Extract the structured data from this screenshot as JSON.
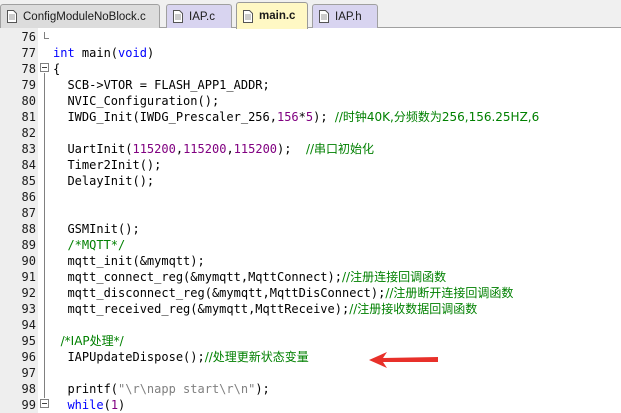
{
  "tabs": [
    {
      "label": "ConfigModuleNoBlock.c",
      "state": "inactive"
    },
    {
      "label": "IAP.c",
      "state": "inactive"
    },
    {
      "label": "main.c",
      "state": "active"
    },
    {
      "label": "IAP.h",
      "state": "inactive"
    }
  ],
  "colors": {
    "keyword": "#0000ff",
    "number": "#800080",
    "string": "#808080",
    "comment": "#008000",
    "arrow": "#e8302a",
    "active_tab": "#fff8c4"
  },
  "annotation": {
    "icon": "red-arrow-icon"
  },
  "lines": [
    {
      "n": "76",
      "parts": [
        {
          "t": ""
        }
      ]
    },
    {
      "n": "77",
      "parts": [
        {
          "t": "int",
          "c": "kw"
        },
        {
          "t": " main("
        },
        {
          "t": "void",
          "c": "kw"
        },
        {
          "t": ")"
        }
      ]
    },
    {
      "n": "78",
      "parts": [
        {
          "t": "{"
        }
      ]
    },
    {
      "n": "79",
      "parts": [
        {
          "t": "  SCB->VTOR = FLASH_APP1_ADDR;"
        }
      ]
    },
    {
      "n": "80",
      "parts": [
        {
          "t": "  NVIC_Configuration();"
        }
      ]
    },
    {
      "n": "81",
      "parts": [
        {
          "t": "  IWDG_Init(IWDG_Prescaler_256,"
        },
        {
          "t": "156",
          "c": "num"
        },
        {
          "t": "*"
        },
        {
          "t": "5",
          "c": "num"
        },
        {
          "t": "); "
        },
        {
          "t": "//时钟40K,分频数为256,156.25HZ,6",
          "c": "cmt"
        }
      ]
    },
    {
      "n": "82",
      "parts": [
        {
          "t": ""
        }
      ]
    },
    {
      "n": "83",
      "parts": [
        {
          "t": "  UartInit("
        },
        {
          "t": "115200",
          "c": "num"
        },
        {
          "t": ","
        },
        {
          "t": "115200",
          "c": "num"
        },
        {
          "t": ","
        },
        {
          "t": "115200",
          "c": "num"
        },
        {
          "t": ");  "
        },
        {
          "t": "//串口初始化",
          "c": "cmt"
        }
      ]
    },
    {
      "n": "84",
      "parts": [
        {
          "t": "  Timer2Init();"
        }
      ]
    },
    {
      "n": "85",
      "parts": [
        {
          "t": "  DelayInit();"
        }
      ]
    },
    {
      "n": "86",
      "parts": [
        {
          "t": ""
        }
      ]
    },
    {
      "n": "87",
      "parts": [
        {
          "t": ""
        }
      ]
    },
    {
      "n": "88",
      "parts": [
        {
          "t": "  GSMInit();"
        }
      ]
    },
    {
      "n": "89",
      "parts": [
        {
          "t": "  /*MQTT*/",
          "c": "cmt"
        }
      ]
    },
    {
      "n": "90",
      "parts": [
        {
          "t": "  mqtt_init(&mymqtt);"
        }
      ]
    },
    {
      "n": "91",
      "parts": [
        {
          "t": "  mqtt_connect_reg(&mymqtt,MqttConnect);"
        },
        {
          "t": "//注册连接回调函数",
          "c": "cmt"
        }
      ]
    },
    {
      "n": "92",
      "parts": [
        {
          "t": "  mqtt_disconnect_reg(&mymqtt,MqttDisConnect);"
        },
        {
          "t": "//注册断开连接回调函数",
          "c": "cmt"
        }
      ]
    },
    {
      "n": "93",
      "parts": [
        {
          "t": "  mqtt_received_reg(&mymqtt,MqttReceive);"
        },
        {
          "t": "//注册接收数据回调函数",
          "c": "cmt"
        }
      ]
    },
    {
      "n": "94",
      "parts": [
        {
          "t": ""
        }
      ]
    },
    {
      "n": "95",
      "parts": [
        {
          "t": "  /*IAP处理*/",
          "c": "cmt"
        }
      ]
    },
    {
      "n": "96",
      "parts": [
        {
          "t": "  IAPUpdateDispose();"
        },
        {
          "t": "//处理更新状态变量",
          "c": "cmt"
        }
      ]
    },
    {
      "n": "97",
      "parts": [
        {
          "t": ""
        }
      ]
    },
    {
      "n": "98",
      "parts": [
        {
          "t": "  printf("
        },
        {
          "t": "\"\\r\\napp start\\r\\n\"",
          "c": "str"
        },
        {
          "t": ");"
        }
      ]
    },
    {
      "n": "99",
      "parts": [
        {
          "t": "  "
        },
        {
          "t": "while",
          "c": "kw"
        },
        {
          "t": "("
        },
        {
          "t": "1",
          "c": "num"
        },
        {
          "t": ")"
        }
      ]
    },
    {
      "n": "100",
      "parts": [
        {
          "t": "  {"
        }
      ]
    }
  ]
}
